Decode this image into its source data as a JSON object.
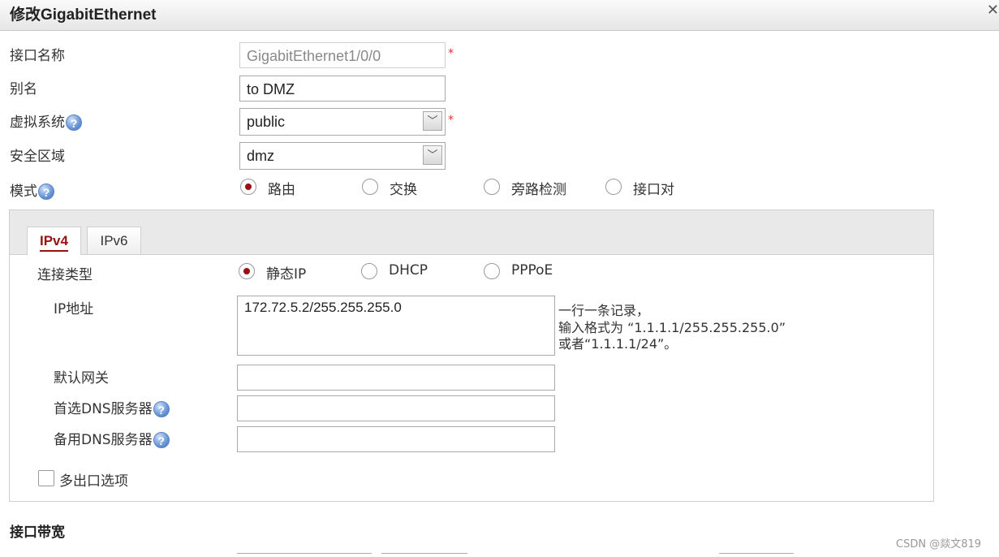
{
  "dialog": {
    "title": "修改GigabitEthernet",
    "close_icon": "close-icon"
  },
  "form": {
    "interface_name": {
      "label": "接口名称",
      "value": "GigabitEthernet1/0/0",
      "required_mark": "*"
    },
    "alias": {
      "label": "别名",
      "value": "to DMZ"
    },
    "virtual_system": {
      "label": "虚拟系统",
      "value": "public",
      "required_mark": "*"
    },
    "security_zone": {
      "label": "安全区域",
      "value": "dmz"
    },
    "mode": {
      "label": "模式",
      "options": [
        "路由",
        "交换",
        "旁路检测",
        "接口对"
      ],
      "selected": "路由"
    }
  },
  "tabs": [
    {
      "label": "IPv4",
      "active": true
    },
    {
      "label": "IPv6",
      "active": false
    }
  ],
  "ipv4": {
    "connection_type": {
      "label": "连接类型",
      "options": [
        "静态IP",
        "DHCP",
        "PPPoE"
      ],
      "selected": "静态IP"
    },
    "ip_address": {
      "label": "IP地址",
      "value": "172.72.5.2/255.255.255.0",
      "hint": [
        "一行一条记录，",
        "输入格式为 “1.1.1.1/255.255.255.0”",
        "或者“1.1.1.1/24”。"
      ]
    },
    "default_gateway": {
      "label": "默认网关",
      "value": ""
    },
    "primary_dns": {
      "label": "首选DNS服务器",
      "value": ""
    },
    "secondary_dns": {
      "label": "备用DNS服务器",
      "value": ""
    },
    "multi_exit": {
      "label": "多出口选项",
      "checked": false
    }
  },
  "bandwidth_section": {
    "title": "接口带宽"
  },
  "help_glyph": "?",
  "dropdown_glyph": "﹀",
  "watermark": "CSDN @燚文819",
  "colors": {
    "accent": "#9b1111",
    "required": "#e03030",
    "help": "#5b86c4"
  }
}
